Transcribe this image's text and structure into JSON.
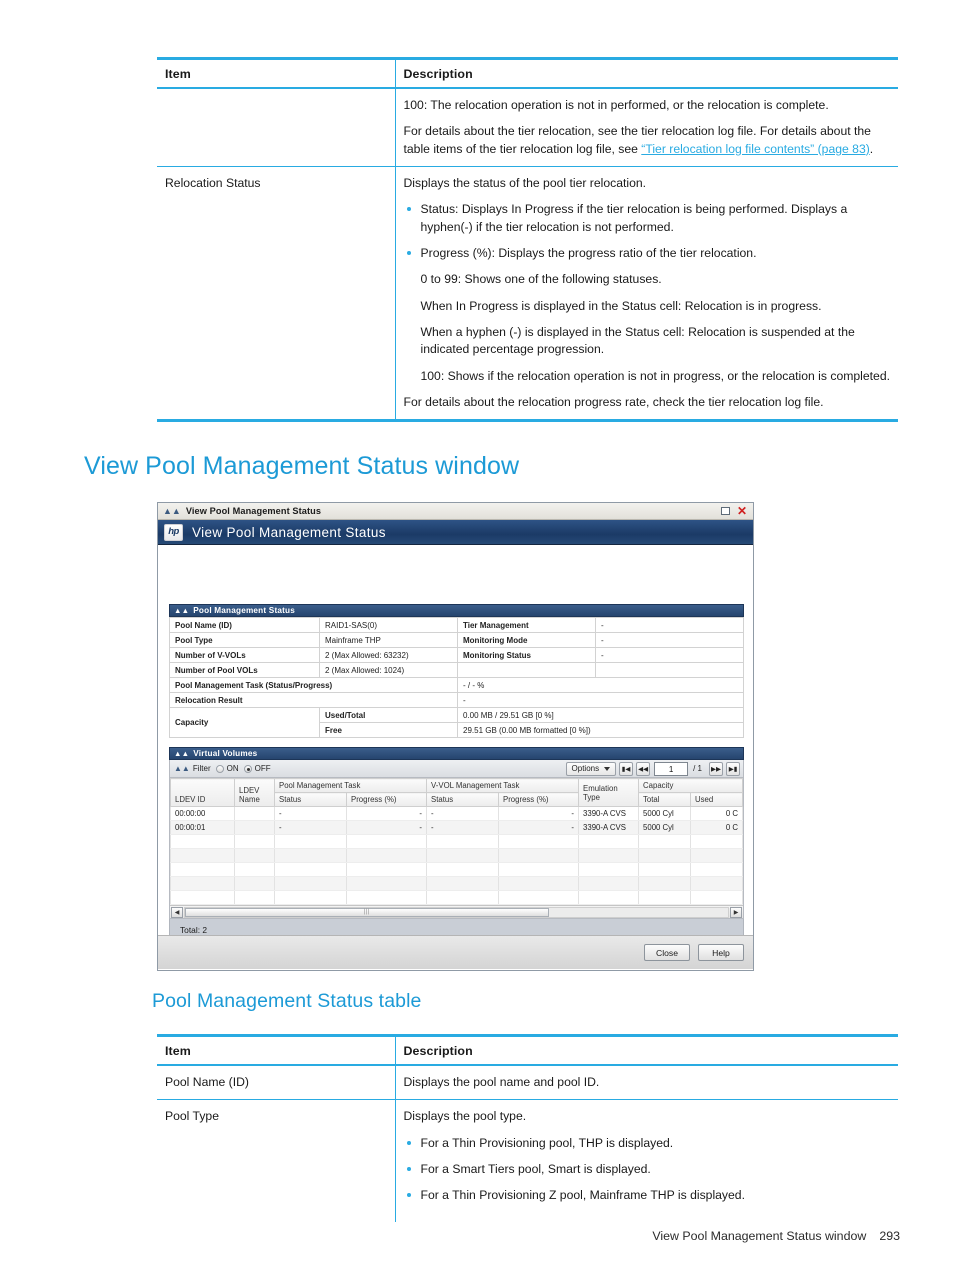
{
  "doc": {
    "top_table": {
      "headers": [
        "Item",
        "Description"
      ],
      "rows": [
        {
          "item": "",
          "paragraphs": [
            "100: The relocation operation is not in performed, or the relocation is complete.",
            "For details about the tier relocation, see the tier relocation log file. For details about the table items of the tier relocation log file, see "
          ],
          "link_text": "“Tier relocation log file contents” (page 83)",
          "link_tail": "."
        },
        {
          "item": "Relocation Status",
          "intro": "Displays the status of the pool tier relocation.",
          "bullets": [
            "Status: Displays In Progress if the tier relocation is being performed. Displays a hyphen(-) if the tier relocation is not performed.",
            "Progress (%): Displays the progress ratio of the tier relocation."
          ],
          "subs": [
            "0 to 99: Shows one of the following statuses.",
            "When In Progress is displayed in the Status cell: Relocation is in progress.",
            "When a hyphen (-) is displayed in the Status cell: Relocation is suspended at the indicated percentage progression.",
            "100: Shows if the relocation operation is not in progress, or the relocation is completed."
          ],
          "outro": "For details about the relocation progress rate, check the tier relocation log file."
        }
      ]
    },
    "heading_window": "View Pool Management Status window",
    "heading_table": "Pool Management Status table",
    "bottom_table": {
      "headers": [
        "Item",
        "Description"
      ],
      "rows": [
        {
          "item": "Pool Name (ID)",
          "intro": "Displays the pool name and pool ID.",
          "bullets": []
        },
        {
          "item": "Pool Type",
          "intro": "Displays the pool type.",
          "bullets": [
            "For a Thin Provisioning pool, THP is displayed.",
            "For a Smart Tiers pool, Smart is displayed.",
            "For a Thin Provisioning Z pool, Mainframe THP is displayed."
          ]
        }
      ]
    },
    "footer": {
      "title": "View Pool Management Status window",
      "page": "293"
    }
  },
  "app": {
    "titlebar": {
      "title": "View Pool Management Status",
      "collapse_icon": "»",
      "restore_label": "",
      "close_label": "✕"
    },
    "banner": {
      "logo_text": "hp",
      "title": "View Pool Management Status"
    },
    "pool_panel": {
      "title": "Pool Management Status",
      "collapse_icon": "»",
      "rows": [
        {
          "l1": "Pool Name (ID)",
          "v1": "RAID1-SAS(0)",
          "l2": "Tier Management",
          "v2": "-"
        },
        {
          "l1": "Pool Type",
          "v1": "Mainframe THP",
          "l2": "Monitoring Mode",
          "v2": "-"
        },
        {
          "l1": "Number of V-VOLs",
          "v1": "2 (Max Allowed: 63232)",
          "l2": "Monitoring Status",
          "v2": "-"
        },
        {
          "l1": "Number of Pool VOLs",
          "v1": "2 (Max Allowed: 1024)",
          "l2": "",
          "v2": ""
        }
      ],
      "task_label": "Pool Management Task (Status/Progress)",
      "task_value": "- / - %",
      "relocation_label": "Relocation Result",
      "relocation_value": "-",
      "capacity_label": "Capacity",
      "capacity_rows": [
        {
          "label": "Used/Total",
          "value": "0.00 MB / 29.51 GB [0 %]"
        },
        {
          "label": "Free",
          "value": "29.51 GB (0.00 MB formatted [0 %])"
        }
      ]
    },
    "vvol_panel": {
      "title": "Virtual Volumes",
      "collapse_icon": "»",
      "filter_label": "Filter",
      "filter_on": "ON",
      "filter_off": "OFF",
      "filter_selected": "OFF",
      "options_label": "Options",
      "page_first": "▮◀",
      "page_prev": "◀◀",
      "page_value": "1",
      "page_of": "/ 1",
      "page_next": "▶▶",
      "page_last": "▶▮",
      "group_headers": {
        "ldev_id": "LDEV ID",
        "ldev_name": "LDEV Name",
        "pool_task": "Pool Management Task",
        "vvol_task": "V-VOL Management Task",
        "emulation": "Emulation Type",
        "capacity": "Capacity"
      },
      "sub_headers": {
        "status": "Status",
        "progress": "Progress (%)",
        "total": "Total",
        "used": "Used"
      },
      "rows": [
        {
          "ldev_id": "00:00:00",
          "ldev_name": "",
          "pool_status": "-",
          "pool_progress": "-",
          "vvol_status": "-",
          "vvol_progress": "-",
          "emulation": "3390-A CVS",
          "total": "5000 Cyl",
          "used": "0 C"
        },
        {
          "ldev_id": "00:00:01",
          "ldev_name": "",
          "pool_status": "-",
          "pool_progress": "-",
          "vvol_status": "-",
          "vvol_progress": "-",
          "emulation": "3390-A CVS",
          "total": "5000 Cyl",
          "used": "0 C"
        }
      ],
      "scroll_left_arrow": "◀",
      "scroll_right_arrow": "▶",
      "total_label": "Total:  2"
    },
    "footer_buttons": {
      "close": "Close",
      "help": "Help"
    }
  },
  "colors": {
    "accent_blue": "#29ABE2",
    "heading_blue": "#1c9ad6",
    "banner_dark": "#1b3a66",
    "panel_header": "#26456e",
    "close_red": "#d02020"
  }
}
